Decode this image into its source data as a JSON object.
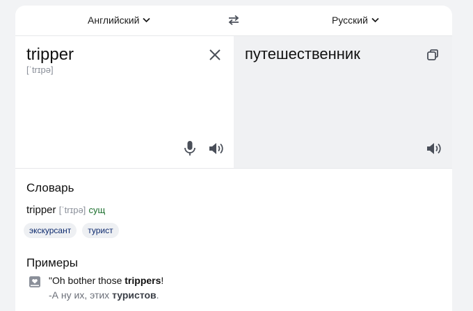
{
  "languages": {
    "source": "Английский",
    "target": "Русский"
  },
  "source_panel": {
    "text": "tripper",
    "transcription": "[ˈtrɪpə]"
  },
  "target_panel": {
    "text": "путешественник"
  },
  "dictionary": {
    "heading": "Словарь",
    "word": "tripper",
    "transcription": "[ˈtrɪpə]",
    "part_of_speech": "сущ",
    "translations": [
      "экскурсант",
      "турист"
    ]
  },
  "examples": {
    "heading": "Примеры",
    "items": [
      {
        "source_before": "\"Oh bother those ",
        "source_highlight": "trippers",
        "source_after": "!",
        "target_before": "-А ну их, этих ",
        "target_highlight": "туристов",
        "target_after": "."
      }
    ]
  },
  "colors": {
    "background": "#f2f3f5",
    "card": "#ffffff",
    "target_panel": "#f0f1f3",
    "icon": "#4a4f59",
    "chip_background": "#eef0f3",
    "chip_text": "#0d2a6e",
    "part_of_speech": "#1a6e2c"
  },
  "icons": [
    "chevron-down-icon",
    "swap-icon",
    "clear-icon",
    "microphone-icon",
    "speaker-icon",
    "copy-icon",
    "bookmark-icon"
  ]
}
